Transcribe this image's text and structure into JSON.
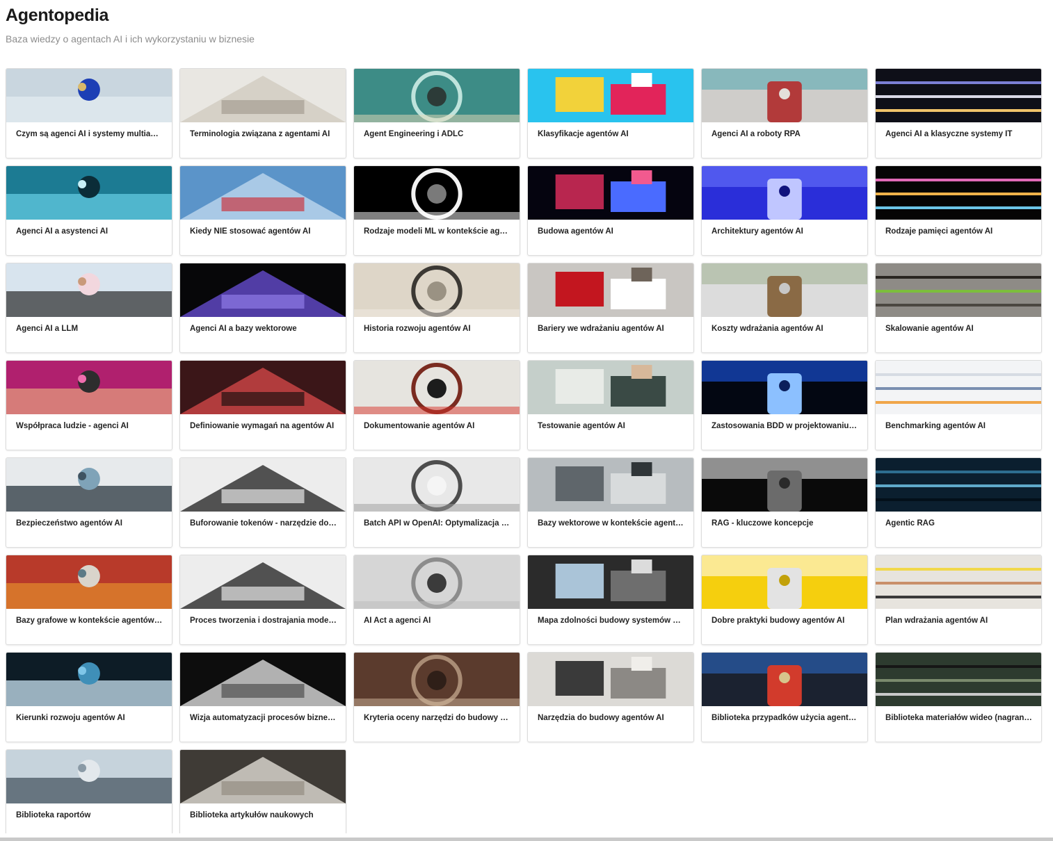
{
  "header": {
    "title": "Agentopedia",
    "subtitle": "Baza wiedzy o agentach AI i ich wykorzystaniu w biznesie"
  },
  "cards": [
    {
      "title": "Czym są agenci AI i systemy multiagentowe",
      "image": "balloons-molecule",
      "palette": [
        "#c9d6df",
        "#e4ecf1",
        "#1d3fb5",
        "#d9b96a"
      ]
    },
    {
      "title": "Terminologia związana z agentami AI",
      "image": "open-book",
      "palette": [
        "#e9e7e2",
        "#cfc9bd",
        "#9c9488",
        "#f4f2ee"
      ]
    },
    {
      "title": "Agent Engineering i ADLC",
      "image": "glass-dome",
      "palette": [
        "#3d8c86",
        "#bfe3dc",
        "#2c3b38",
        "#e7d9b8"
      ]
    },
    {
      "title": "Klasyfikacje agentów AI",
      "image": "colored-blocks",
      "palette": [
        "#29c3ee",
        "#f2d23a",
        "#e2245a",
        "#ffffff"
      ]
    },
    {
      "title": "Agenci AI a roboty RPA",
      "image": "toy-robot",
      "palette": [
        "#cfcdca",
        "#4fa8b1",
        "#b23a3a",
        "#e3e0db"
      ]
    },
    {
      "title": "Agenci AI a klasyczne systemy IT",
      "image": "code-screen",
      "palette": [
        "#0e0f18",
        "#7b7fd6",
        "#d9d9e8",
        "#f0c36a"
      ]
    },
    {
      "title": "Agenci AI a asystenci AI",
      "image": "cyan-robot",
      "palette": [
        "#1c7b93",
        "#67d0e6",
        "#0b2d38",
        "#c8f0f7"
      ]
    },
    {
      "title": "Kiedy NIE stosować agentów AI",
      "image": "no-entry-sign",
      "palette": [
        "#5b94c9",
        "#c3dbef",
        "#d12228",
        "#2a2a2a"
      ]
    },
    {
      "title": "Rodzaje modeli ML w kontekście agentów AI",
      "image": "light-tunnel",
      "palette": [
        "#000000",
        "#f2f2f2",
        "#7a7a7a",
        "#ffffff"
      ]
    },
    {
      "title": "Budowa agentów AI",
      "image": "plasma-ball",
      "palette": [
        "#05040f",
        "#b8264f",
        "#4a6bff",
        "#f25a8f"
      ]
    },
    {
      "title": "Architektury agentów AI",
      "image": "blue-building",
      "palette": [
        "#2a2ed9",
        "#6f7cff",
        "#c0c6ff",
        "#11137d"
      ]
    },
    {
      "title": "Rodzaje pamięci agentów AI",
      "image": "flower-brain",
      "palette": [
        "#050505",
        "#e06ab7",
        "#f0b34a",
        "#6bc6e8"
      ]
    },
    {
      "title": "Agenci AI a LLM",
      "image": "phone-apps",
      "palette": [
        "#d8e4ee",
        "#2b2b2b",
        "#f2d7de",
        "#c99a7a"
      ]
    },
    {
      "title": "Agenci AI a bazy wektorowe",
      "image": "purple-knot",
      "palette": [
        "#070709",
        "#6b50d9",
        "#9a86f2",
        "#2b1d6b"
      ]
    },
    {
      "title": "Historia rozwoju agentów AI",
      "image": "columns-hall",
      "palette": [
        "#ded6c8",
        "#3c3934",
        "#9a9283",
        "#f1ece3"
      ]
    },
    {
      "title": "Bariery we wdrażaniu agentów AI",
      "image": "stop-sign",
      "palette": [
        "#c9c6c2",
        "#c3161f",
        "#ffffff",
        "#6e645a"
      ]
    },
    {
      "title": "Koszty wdrażania agentów AI",
      "image": "dollar-coins",
      "palette": [
        "#dcdcdc",
        "#9fb08f",
        "#8a6a45",
        "#c7c7c7"
      ]
    },
    {
      "title": "Skalowanie agentów AI",
      "image": "seedlings",
      "palette": [
        "#8e8b86",
        "#2a2621",
        "#7cbf3c",
        "#4b4741"
      ]
    },
    {
      "title": "Współpraca ludzie - agenci AI",
      "image": "hand-robot",
      "palette": [
        "#b0206e",
        "#e7a37d",
        "#2d2d2d",
        "#f06dae"
      ]
    },
    {
      "title": "Definiowanie wymagań na agentów AI",
      "image": "question-neon",
      "palette": [
        "#3b1618",
        "#d9494a",
        "#0a0a0a",
        "#f2d0c4"
      ]
    },
    {
      "title": "Dokumentowanie agentów AI",
      "image": "whiteboard-people",
      "palette": [
        "#e6e4df",
        "#7a2b20",
        "#1c1c1c",
        "#d8342c"
      ]
    },
    {
      "title": "Testowanie agentów AI",
      "image": "desk-papers",
      "palette": [
        "#c5cfca",
        "#e8ebe7",
        "#3a4a45",
        "#d7b89a"
      ]
    },
    {
      "title": "Zastosowania BDD w projektowaniu i testowaniu agentów AI",
      "image": "blue-screen-person",
      "palette": [
        "#030712",
        "#1e5fff",
        "#8cc0ff",
        "#0b1f5c"
      ]
    },
    {
      "title": "Benchmarking agentów AI",
      "image": "ux-sketches",
      "palette": [
        "#f3f4f6",
        "#d6dbe3",
        "#7a8fb0",
        "#f0a64a"
      ]
    },
    {
      "title": "Bezpieczeństwo agentów AI",
      "image": "camera-lens",
      "palette": [
        "#e7eaec",
        "#1d2a33",
        "#7fa3b8",
        "#3f5361"
      ]
    },
    {
      "title": "Buforowanie tokenów - narzędzie do optymalizacji kosztów",
      "image": "whiteboard-text",
      "palette": [
        "#ededed",
        "#1c1c1c",
        "#ffffff",
        "#9a9a9a"
      ]
    },
    {
      "title": "Batch API w OpenAI: Optymalizacja kosztów",
      "image": "openai-paper",
      "palette": [
        "#e8e8e8",
        "#4d4d4d",
        "#f5f5f5",
        "#9b9b9b"
      ]
    },
    {
      "title": "Bazy wektorowe w kontekście agentów AI",
      "image": "foggy-grid",
      "palette": [
        "#b7bcbf",
        "#5f666b",
        "#d8dbdc",
        "#2f3538"
      ]
    },
    {
      "title": "RAG - kluczowe koncepcje",
      "image": "floating-cards",
      "palette": [
        "#0a0a0a",
        "#ffffff",
        "#6b6b6b",
        "#2a2a2a"
      ]
    },
    {
      "title": "Agentic RAG",
      "image": "wave-mesh",
      "palette": [
        "#0b1f2f",
        "#2d6d8f",
        "#5fa9c9",
        "#03101a"
      ]
    },
    {
      "title": "Bazy grafowe w kontekście agentów AI",
      "image": "lockers",
      "palette": [
        "#b83a2a",
        "#e38b2c",
        "#d9d4cb",
        "#5c7a86"
      ]
    },
    {
      "title": "Proces tworzenia i dostrajania modeli LLM",
      "image": "whiteboard-text-2",
      "palette": [
        "#ededed",
        "#1c1c1c",
        "#ffffff",
        "#9a9a9a"
      ]
    },
    {
      "title": "AI Act a agenci AI",
      "image": "justice-statue",
      "palette": [
        "#d6d6d6",
        "#8c8c8c",
        "#3b3b3b",
        "#b9b9b9"
      ]
    },
    {
      "title": "Mapa zdolności budowy systemów agentowych",
      "image": "corridor-sky",
      "palette": [
        "#2b2b2b",
        "#aac4d8",
        "#6e6e6e",
        "#dcdcdc"
      ]
    },
    {
      "title": "Dobre praktyki budowy agentów AI",
      "image": "yellow-paper",
      "palette": [
        "#f5cf0e",
        "#ffffff",
        "#e3e3e3",
        "#c2a10a"
      ]
    },
    {
      "title": "Plan wdrażania agentów AI",
      "image": "sticky-notes",
      "palette": [
        "#e7e4de",
        "#f1d84a",
        "#c98f6a",
        "#3a3a3a"
      ]
    },
    {
      "title": "Kierunki rozwoju agentów AI",
      "image": "light-speed",
      "palette": [
        "#0d1c26",
        "#d6f0ff",
        "#3f8fb8",
        "#7fc6e8"
      ]
    },
    {
      "title": "Wizja automatyzacji procesów biznesowych",
      "image": "do-something-great",
      "palette": [
        "#0d0d0d",
        "#e8e8e8",
        "#404040",
        "#9a9a9a"
      ]
    },
    {
      "title": "Kryteria oceny narzędzi do budowy agentów AI",
      "image": "wrenches",
      "palette": [
        "#5b3b2d",
        "#a98c75",
        "#2f1f18",
        "#d2b79e"
      ]
    },
    {
      "title": "Narzędzia do budowy agentów AI",
      "image": "tool-wall",
      "palette": [
        "#dcdad6",
        "#3a3a3a",
        "#8c8985",
        "#f0eeea"
      ]
    },
    {
      "title": "Biblioteka przypadków użycia agentów AI",
      "image": "toy-robots",
      "palette": [
        "#1b2230",
        "#2d6fd1",
        "#d23b2c",
        "#d7c58c"
      ]
    },
    {
      "title": "Biblioteka materiałów wideo (nagrania)",
      "image": "video-camera",
      "palette": [
        "#2d3b2f",
        "#161616",
        "#7a8a6d",
        "#c9c9c9"
      ]
    },
    {
      "title": "Biblioteka raportów",
      "image": "laptop-desk",
      "palette": [
        "#c6d3dc",
        "#3f4d59",
        "#e3e8ec",
        "#8a9aa6"
      ]
    },
    {
      "title": "Biblioteka artykułów naukowych",
      "image": "notebook-glasses",
      "palette": [
        "#3f3b36",
        "#ebe7df",
        "#8d8579",
        "#1a1816"
      ]
    }
  ]
}
